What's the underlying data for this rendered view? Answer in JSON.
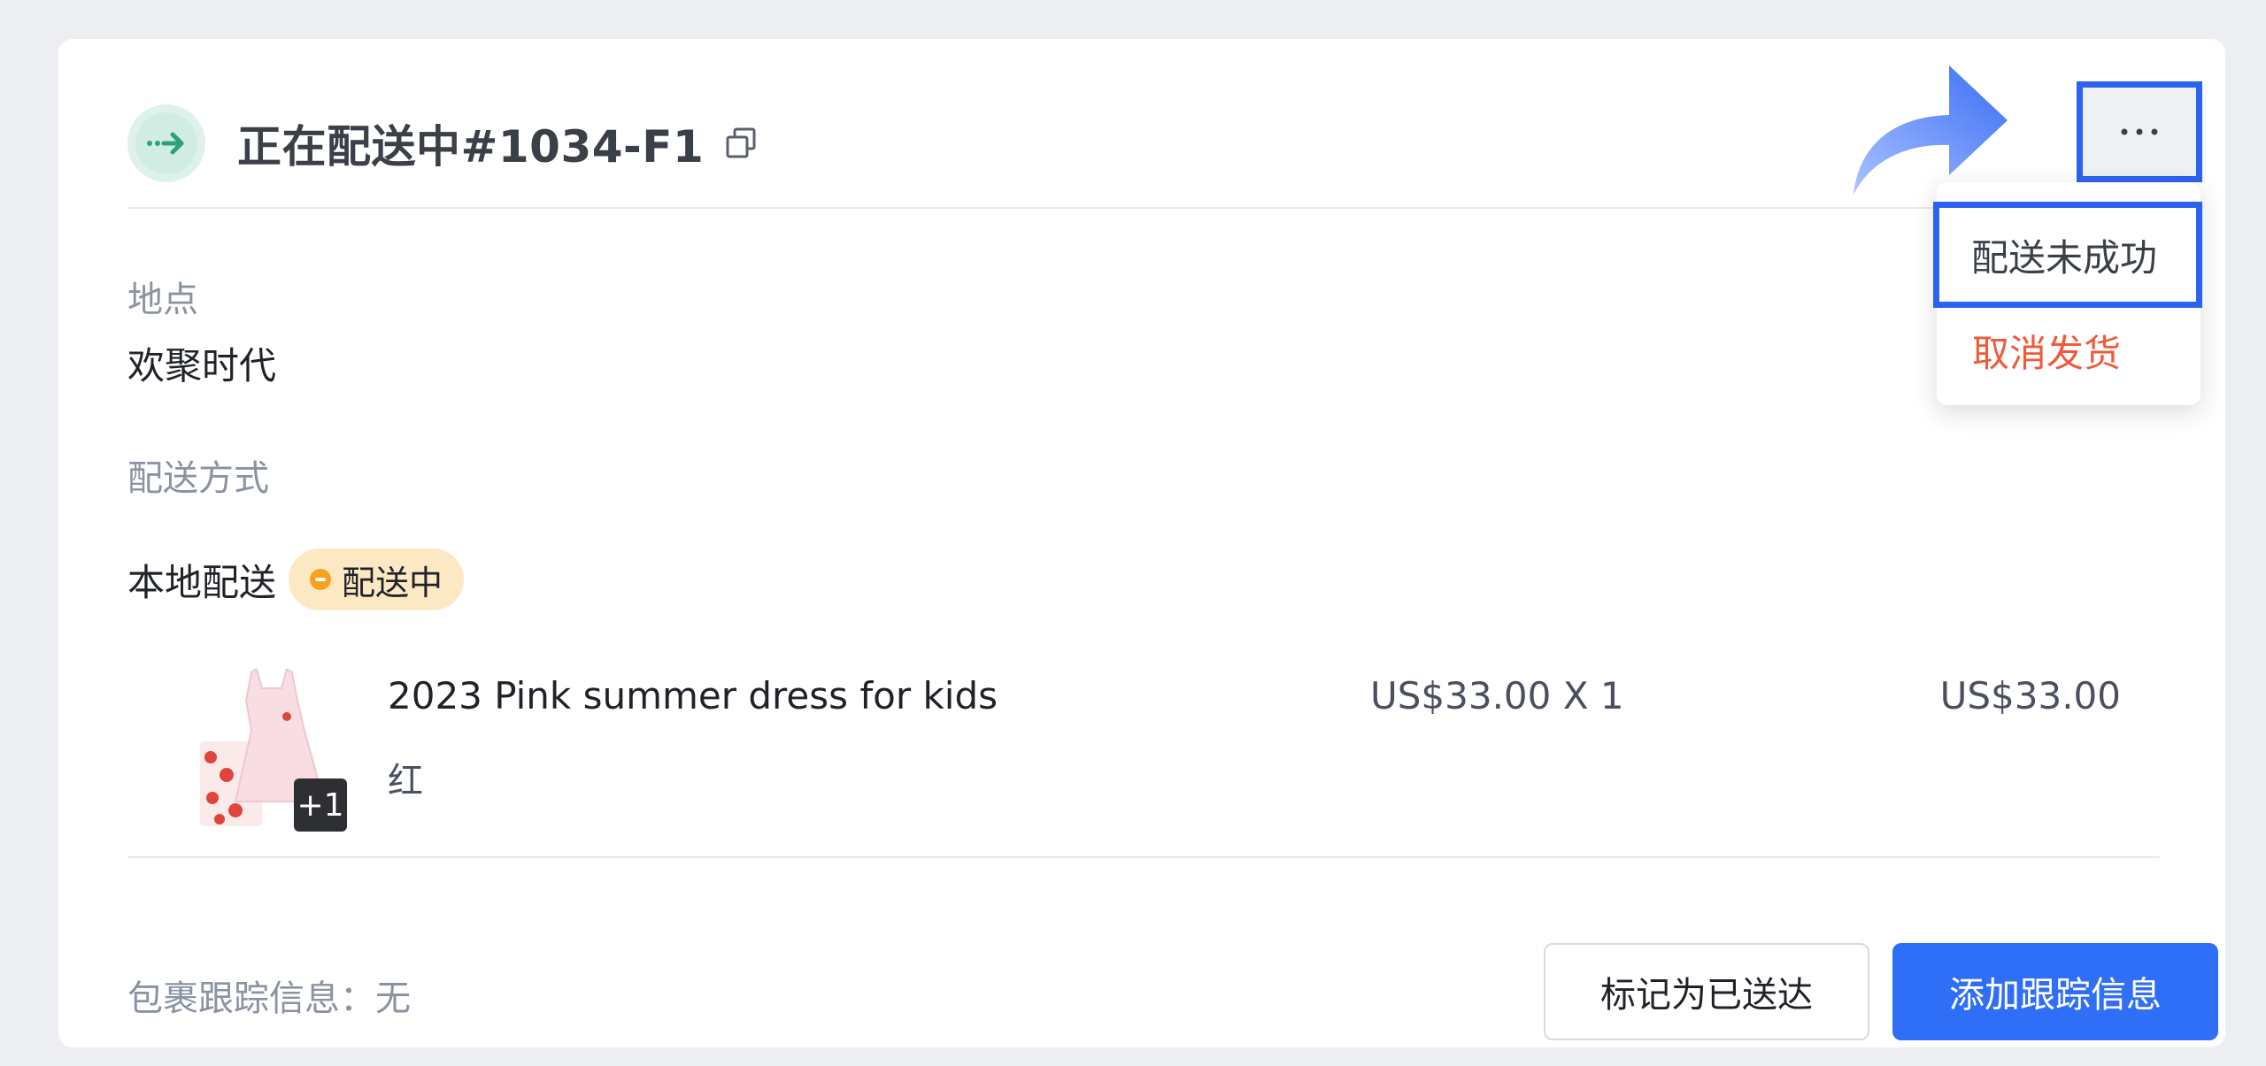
{
  "header": {
    "title": "正在配送中#1034-F1",
    "status_icon": "arrow-right-dotted-icon",
    "copy_icon": "copy-icon",
    "more_icon": "more-horizontal-icon"
  },
  "location": {
    "label": "地点",
    "value": "欢聚时代"
  },
  "delivery": {
    "label": "配送方式",
    "value": "本地配送",
    "badge": "配送中"
  },
  "product": {
    "name": "2023 Pink summer dress for kids",
    "variant": "红",
    "unit_price": "US$33.00 X 1",
    "total": "US$33.00",
    "extra_count": "+1"
  },
  "footer": {
    "tracking_label": "包裹跟踪信息：",
    "tracking_value": "无",
    "mark_delivered": "标记为已送达",
    "add_tracking": "添加跟踪信息"
  },
  "menu": {
    "items": [
      {
        "label": "配送未成功"
      },
      {
        "label": "取消发货"
      }
    ]
  },
  "colors": {
    "primary": "#2f6ef6",
    "danger": "#ef5b3a",
    "badge_bg": "#fde8c4",
    "badge_dot": "#f7a21c",
    "status_green": "#2aa37c",
    "highlight": "#2d62f0"
  }
}
